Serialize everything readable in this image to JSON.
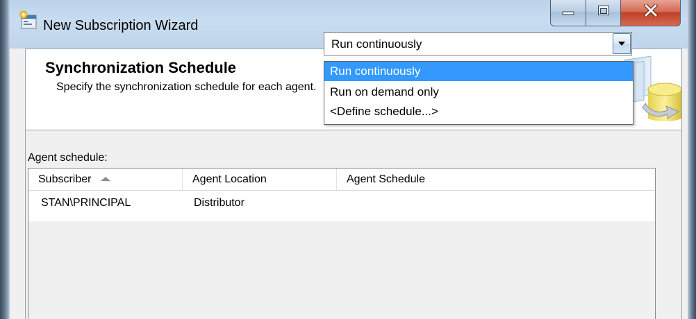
{
  "window": {
    "title": "New Subscription Wizard",
    "controls": [
      "minimize-icon",
      "maximize-icon",
      "close-icon"
    ]
  },
  "header": {
    "title": "Synchronization Schedule",
    "subtitle": "Specify the synchronization schedule for each agent."
  },
  "agent_schedule": {
    "label": "Agent schedule:",
    "columns": [
      "Subscriber",
      "Agent Location",
      "Agent Schedule"
    ],
    "sorted_column": "Subscriber",
    "rows": [
      {
        "subscriber": "STAN\\PRINCIPAL",
        "agent_location": "Distributor",
        "agent_schedule": "Run continuously"
      }
    ],
    "dropdown": {
      "options": [
        "Run continuously",
        "Run on demand only",
        "<Define schedule...>"
      ],
      "highlighted": "Run continuously"
    }
  },
  "colors": {
    "titlebar": "#c0d5ea",
    "selection": "#3399ff",
    "close_button": "#c8492f"
  }
}
